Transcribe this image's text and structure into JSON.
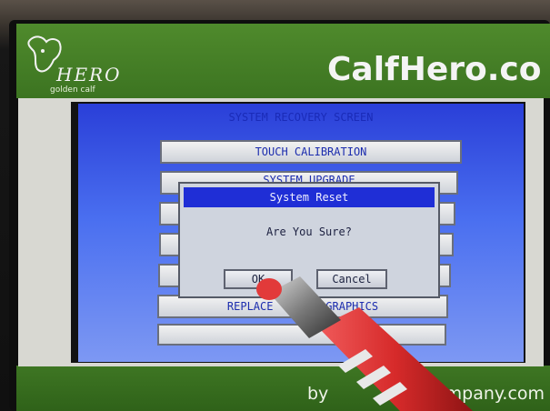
{
  "branding": {
    "logo_text": "HERO",
    "logo_sub": "golden calf",
    "name": "CalfHero.co",
    "bottom_left": "by",
    "bottom_right": "ompany.com"
  },
  "screen": {
    "title": "SYSTEM RECOVERY SCREEN",
    "menu": [
      {
        "label": "TOUCH CALIBRATION"
      },
      {
        "label": "SYSTEM UPGRADE"
      },
      {
        "label": ""
      },
      {
        "label": ""
      },
      {
        "label": ""
      },
      {
        "label": "REPLACE        GRAPHICS"
      },
      {
        "label": ""
      }
    ]
  },
  "dialog": {
    "title": "System Reset",
    "message": "Are You Sure?",
    "ok_label": "OK",
    "cancel_label": "Cancel"
  },
  "colors": {
    "brand_green": "#3c7421",
    "dialog_title_bg": "#1f2ed6",
    "lcd_blue": "#2a3fd8"
  }
}
